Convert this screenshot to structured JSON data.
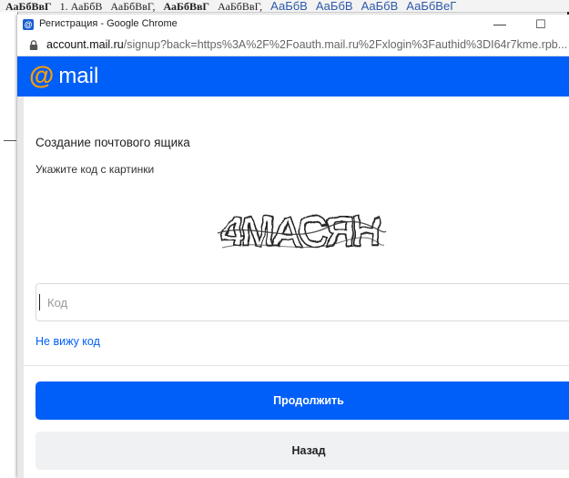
{
  "background_doc": {
    "ribbon_items": [
      "АаБбВвГ",
      "1. АаБбВ",
      "АаБбВвГ,",
      "АаБбВвГ",
      "АаБбВвГ,",
      "АаБбВ",
      "АаБбВ",
      "АаБбВ",
      "АаБбВеГ"
    ]
  },
  "window": {
    "title": "Регистрация - Google Chrome",
    "favicon": "@",
    "minimize_glyph": "—",
    "maximize_glyph": "☐"
  },
  "address": {
    "domain": "account.mail.ru",
    "rest": "/signup?back=https%3A%2F%2Foauth.mail.ru%2Fxlogin%3Fauthid%3DI64r7kme.rpb..."
  },
  "header": {
    "logo_at": "@",
    "logo_word": "mail",
    "brand_color": "#005ff9",
    "at_color": "#ff9e00"
  },
  "form": {
    "title": "Создание почтового ящика",
    "hint": "Укажите код с картинки",
    "captcha_text": "4MACЯH",
    "code_placeholder": "Код",
    "code_value": "",
    "no_code_link": "Не вижу код",
    "continue_label": "Продолжить",
    "back_label": "Назад"
  }
}
